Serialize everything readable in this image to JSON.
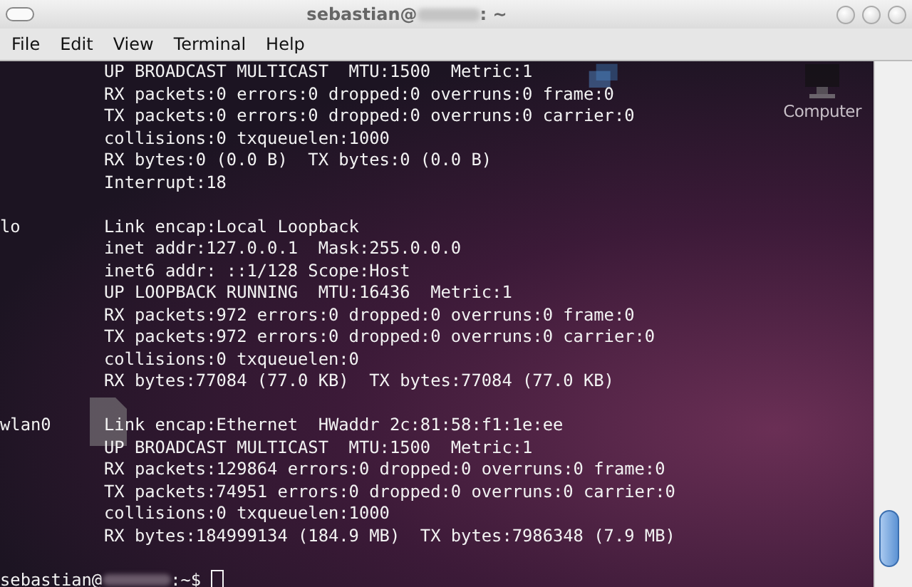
{
  "window": {
    "title_user": "sebastian@",
    "title_suffix": ": ~"
  },
  "menu": [
    {
      "label": "File"
    },
    {
      "label": "Edit"
    },
    {
      "label": "View"
    },
    {
      "label": "Terminal"
    },
    {
      "label": "Help"
    }
  ],
  "desktop_icons": [
    {
      "label": "Computer",
      "kind": "computer"
    }
  ],
  "interfaces": [
    {
      "lines": [
        "UP BROADCAST MULTICAST  MTU:1500  Metric:1",
        "RX packets:0 errors:0 dropped:0 overruns:0 frame:0",
        "TX packets:0 errors:0 dropped:0 overruns:0 carrier:0",
        "collisions:0 txqueuelen:1000",
        "RX bytes:0 (0.0 B)  TX bytes:0 (0.0 B)",
        "Interrupt:18"
      ]
    },
    {
      "name": "lo",
      "lines": [
        "Link encap:Local Loopback",
        "inet addr:127.0.0.1  Mask:255.0.0.0",
        "inet6 addr: ::1/128 Scope:Host",
        "UP LOOPBACK RUNNING  MTU:16436  Metric:1",
        "RX packets:972 errors:0 dropped:0 overruns:0 frame:0",
        "TX packets:972 errors:0 dropped:0 overruns:0 carrier:0",
        "collisions:0 txqueuelen:0",
        "RX bytes:77084 (77.0 KB)  TX bytes:77084 (77.0 KB)"
      ]
    },
    {
      "name": "wlan0",
      "lines": [
        "Link encap:Ethernet  HWaddr 2c:81:58:f1:1e:ee",
        "UP BROADCAST MULTICAST  MTU:1500  Metric:1",
        "RX packets:129864 errors:0 dropped:0 overruns:0 frame:0",
        "TX packets:74951 errors:0 dropped:0 overruns:0 carrier:0",
        "collisions:0 txqueuelen:1000",
        "RX bytes:184999134 (184.9 MB)  TX bytes:7986348 (7.9 MB)"
      ]
    }
  ],
  "prompt": {
    "user": "sebastian@",
    "suffix": ":~$"
  }
}
